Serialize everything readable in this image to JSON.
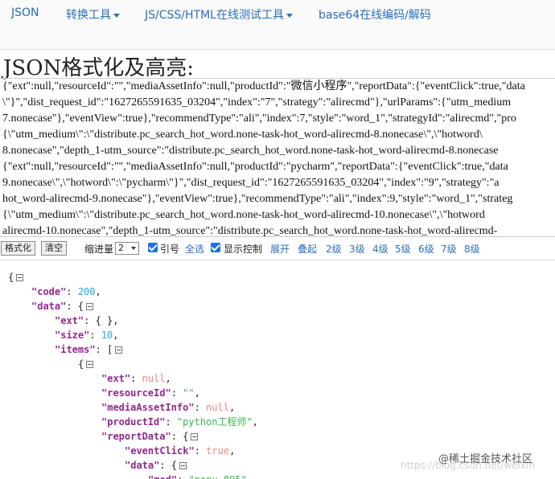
{
  "nav": {
    "items": [
      {
        "label": "JSON"
      },
      {
        "label": "转换工具"
      },
      {
        "label": "JS/CSS/HTML在线测试工具"
      },
      {
        "label": "base64在线编码/解码"
      }
    ]
  },
  "page_title": "JSON格式化及高亮:",
  "raw_lines": [
    "{\"ext\":null,\"resourceId\":\"\",\"mediaAssetInfo\":null,\"productId\":\"微信小程序\",\"reportData\":{\"eventClick\":true,\"data",
    "\\\"}\",\"dist_request_id\":\"1627265591635_03204\",\"index\":\"7\",\"strategy\":\"alirecmd\"},\"urlParams\":{\"utm_medium",
    "7.nonecase\"},\"eventView\":true},\"recommendType\":\"ali\",\"index\":7,\"style\":\"word_1\",\"strategyId\":\"alirecmd\",\"pro",
    "{\\\"utm_medium\\\":\\\"distribute.pc_search_hot_word.none-task-hot_word-alirecmd-8.nonecase\\\",\\\"hotword\\",
    "8.nonecase\",\"depth_1-utm_source\":\"distribute.pc_search_hot_word.none-task-hot_word-alirecmd-8.nonecase",
    "{\"ext\":null,\"resourceId\":\"\",\"mediaAssetInfo\":null,\"productId\":\"pycharm\",\"reportData\":{\"eventClick\":true,\"data",
    "9.nonecase\\\",\\\"hotword\\\":\\\"pycharm\\\"}\",\"dist_request_id\":\"1627265591635_03204\",\"index\":\"9\",\"strategy\":\"a",
    "hot_word-alirecmd-9.nonecase\"},\"eventView\":true},\"recommendType\":\"ali\",\"index\":9,\"style\":\"word_1\",\"strateg",
    "{\\\"utm_medium\\\":\\\"distribute.pc_search_hot_word.none-task-hot_word-alirecmd-10.nonecase\\\",\\\"hotword",
    "alirecmd-10.nonecase\",\"depth_1-utm_source\":\"distribute.pc_search_hot_word.none-task-hot_word-alirecmd-"
  ],
  "toolbar": {
    "format_label": "格式化",
    "clear_label": "清空",
    "indent_label": "缩进量",
    "indent_value": "2",
    "quote_label": "引号",
    "select_all_label": "全选",
    "show_control_label": "显示控制",
    "expand_label": "展开",
    "collapse_label": "叠起",
    "levels": [
      "2级",
      "3级",
      "4级",
      "5级",
      "6级",
      "7级",
      "8级"
    ]
  },
  "json_view": [
    {
      "indent": 0,
      "tokens": [
        {
          "t": "p",
          "v": "{"
        }
      ],
      "fold": true
    },
    {
      "indent": 1,
      "tokens": [
        {
          "t": "k",
          "v": "\"code\""
        },
        {
          "t": "p",
          "v": ": "
        },
        {
          "t": "n",
          "v": "200"
        },
        {
          "t": "p",
          "v": ","
        }
      ]
    },
    {
      "indent": 1,
      "tokens": [
        {
          "t": "k",
          "v": "\"data\""
        },
        {
          "t": "p",
          "v": ": {"
        }
      ],
      "fold": true
    },
    {
      "indent": 2,
      "tokens": [
        {
          "t": "k",
          "v": "\"ext\""
        },
        {
          "t": "p",
          "v": ": { },"
        }
      ]
    },
    {
      "indent": 2,
      "tokens": [
        {
          "t": "k",
          "v": "\"size\""
        },
        {
          "t": "p",
          "v": ": "
        },
        {
          "t": "n",
          "v": "10"
        },
        {
          "t": "p",
          "v": ","
        }
      ]
    },
    {
      "indent": 2,
      "tokens": [
        {
          "t": "k",
          "v": "\"items\""
        },
        {
          "t": "p",
          "v": ": ["
        }
      ],
      "fold": true
    },
    {
      "indent": 3,
      "tokens": [
        {
          "t": "p",
          "v": "{"
        }
      ],
      "fold": true
    },
    {
      "indent": 4,
      "tokens": [
        {
          "t": "k",
          "v": "\"ext\""
        },
        {
          "t": "p",
          "v": ": "
        },
        {
          "t": "b",
          "v": "null"
        },
        {
          "t": "p",
          "v": ","
        }
      ]
    },
    {
      "indent": 4,
      "tokens": [
        {
          "t": "k",
          "v": "\"resourceId\""
        },
        {
          "t": "p",
          "v": ": "
        },
        {
          "t": "s",
          "v": "\"\""
        },
        {
          "t": "p",
          "v": ","
        }
      ]
    },
    {
      "indent": 4,
      "tokens": [
        {
          "t": "k",
          "v": "\"mediaAssetInfo\""
        },
        {
          "t": "p",
          "v": ": "
        },
        {
          "t": "b",
          "v": "null"
        },
        {
          "t": "p",
          "v": ","
        }
      ]
    },
    {
      "indent": 4,
      "tokens": [
        {
          "t": "k",
          "v": "\"productId\""
        },
        {
          "t": "p",
          "v": ": "
        },
        {
          "t": "s",
          "v": "\"python工程师\""
        },
        {
          "t": "p",
          "v": ","
        }
      ]
    },
    {
      "indent": 4,
      "tokens": [
        {
          "t": "k",
          "v": "\"reportData\""
        },
        {
          "t": "p",
          "v": ": {"
        }
      ],
      "fold": true
    },
    {
      "indent": 5,
      "tokens": [
        {
          "t": "k",
          "v": "\"eventClick\""
        },
        {
          "t": "p",
          "v": ": "
        },
        {
          "t": "b",
          "v": "true"
        },
        {
          "t": "p",
          "v": ","
        }
      ]
    },
    {
      "indent": 5,
      "tokens": [
        {
          "t": "k",
          "v": "\"data\""
        },
        {
          "t": "p",
          "v": ": {"
        }
      ],
      "fold": true
    },
    {
      "indent": 6,
      "tokens": [
        {
          "t": "k",
          "v": "\"mod\""
        },
        {
          "t": "p",
          "v": ": "
        },
        {
          "t": "s",
          "v": "\"popu_895\""
        }
      ]
    }
  ],
  "watermark": "@稀土掘金技术社区",
  "watermark_sub": "https://blog.csdn.net/weixin"
}
